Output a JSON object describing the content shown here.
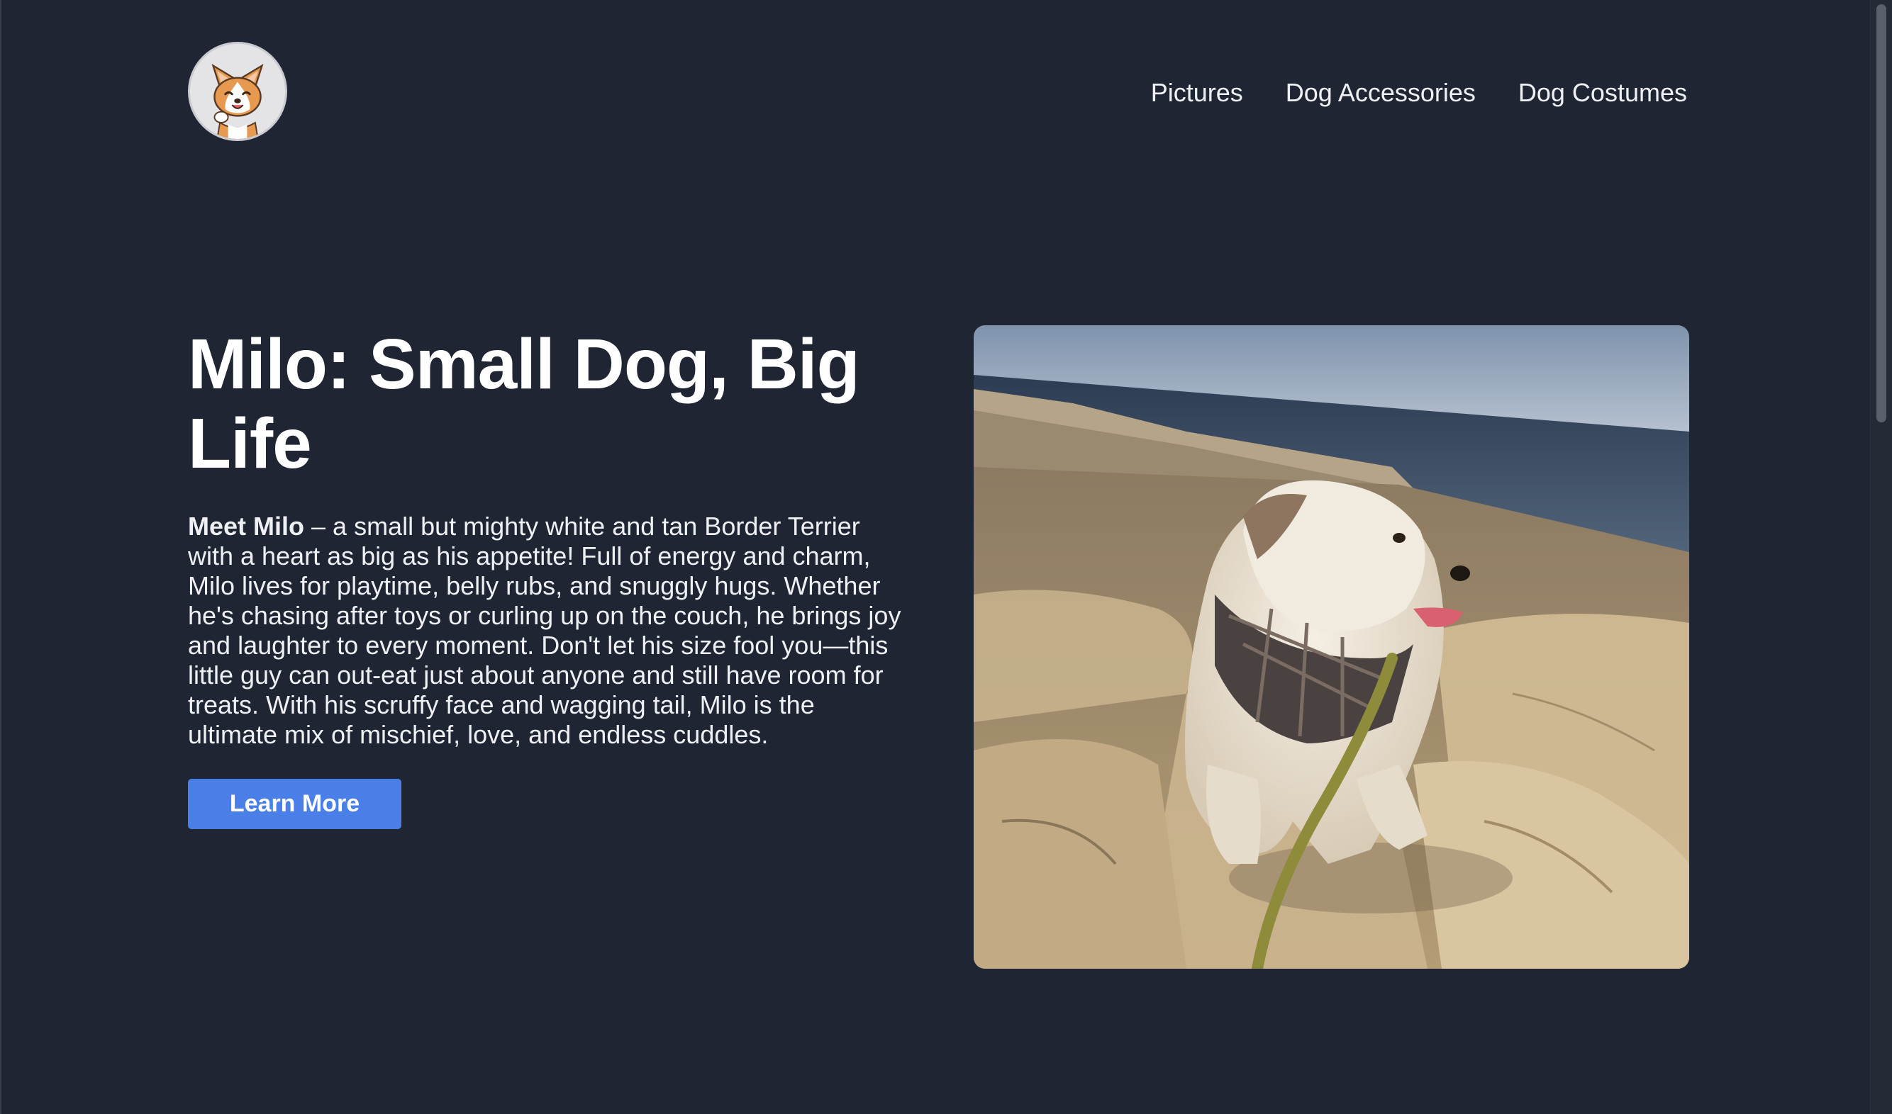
{
  "header": {
    "logo_alt": "corgi-logo",
    "nav": [
      {
        "label": "Pictures"
      },
      {
        "label": "Dog Accessories"
      },
      {
        "label": "Dog Costumes"
      }
    ]
  },
  "hero": {
    "title": "Milo: Small Dog, Big Life",
    "intro_bold": "Meet Milo",
    "intro_rest": " – a small but mighty white and tan Border Terrier with a heart as big as his appetite! Full of energy and charm, Milo lives for playtime, belly rubs, and snuggly hugs. Whether he's chasing after toys or curling up on the couch, he brings joy and laughter to every moment. Don't let his size fool you—this little guy can out-eat just about anyone and still have room for treats. With his scruffy face and wagging tail, Milo is the ultimate mix of mischief, love, and endless cuddles.",
    "button_label": "Learn More",
    "photo_subject": "dog-on-coastal-rocks"
  },
  "colors": {
    "background": "#1f2533",
    "accent": "#4a7fe8",
    "text": "#eef0f4"
  }
}
